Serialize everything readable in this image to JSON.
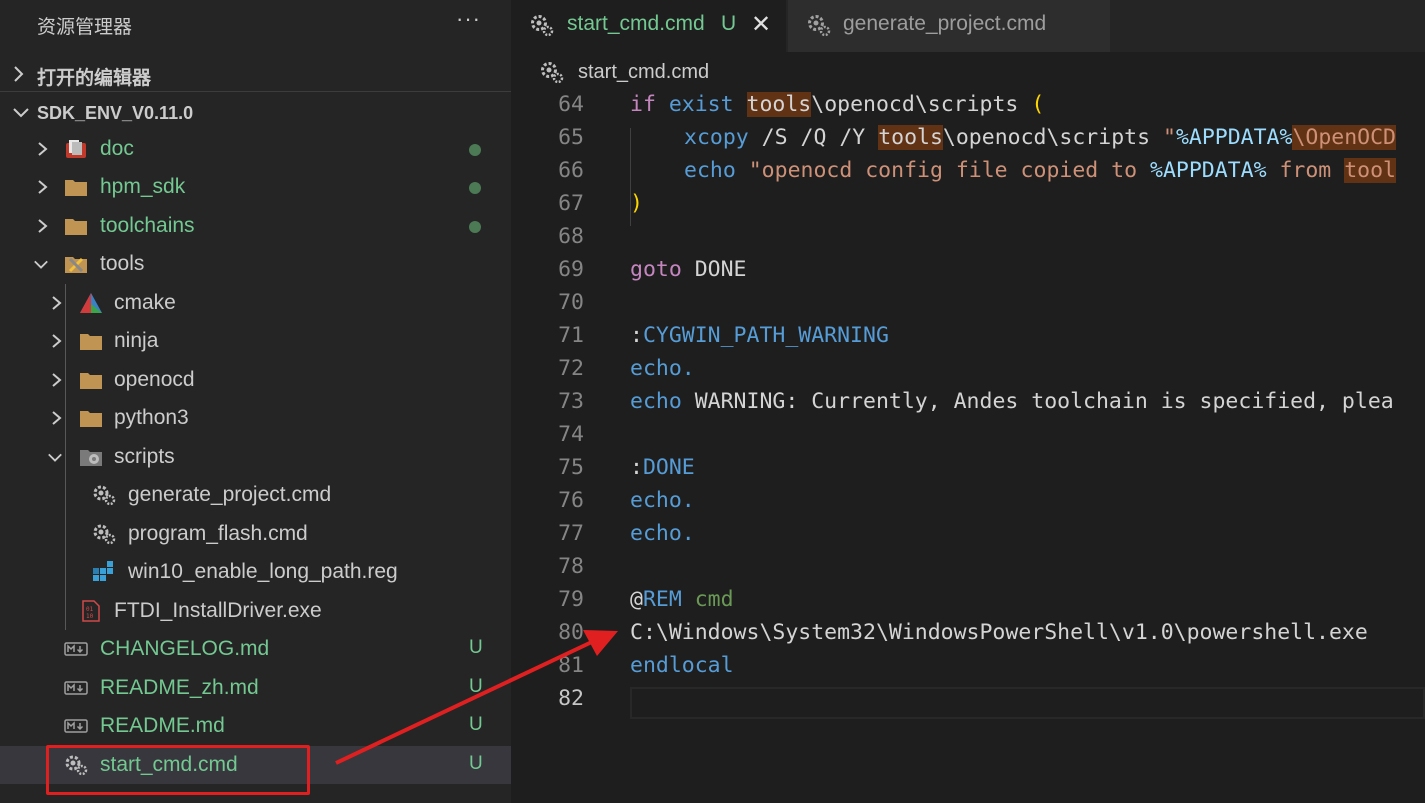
{
  "explorer": {
    "title": "资源管理器",
    "more": "···",
    "open_editors": "打开的编辑器",
    "root": "SDK_ENV_V0.11.0",
    "items": [
      {
        "label": "doc",
        "icon": "doc-folder-icon",
        "state": "dot"
      },
      {
        "label": "hpm_sdk",
        "icon": "folder-icon",
        "state": "dot"
      },
      {
        "label": "toolchains",
        "icon": "folder-icon",
        "state": "dot"
      },
      {
        "label": "tools",
        "icon": "tools-folder-icon",
        "state": ""
      },
      {
        "label": "cmake",
        "icon": "cmake-icon",
        "state": ""
      },
      {
        "label": "ninja",
        "icon": "folder-icon",
        "state": ""
      },
      {
        "label": "openocd",
        "icon": "folder-icon",
        "state": ""
      },
      {
        "label": "python3",
        "icon": "folder-icon",
        "state": ""
      },
      {
        "label": "scripts",
        "icon": "scripts-folder-icon",
        "state": ""
      },
      {
        "label": "generate_project.cmd",
        "icon": "gear-icon",
        "state": ""
      },
      {
        "label": "program_flash.cmd",
        "icon": "gear-icon",
        "state": ""
      },
      {
        "label": "win10_enable_long_path.reg",
        "icon": "registry-icon",
        "state": ""
      },
      {
        "label": "FTDI_InstallDriver.exe",
        "icon": "binary-icon",
        "state": ""
      },
      {
        "label": "CHANGELOG.md",
        "icon": "markdown-icon",
        "state": "U"
      },
      {
        "label": "README_zh.md",
        "icon": "markdown-icon",
        "state": "U"
      },
      {
        "label": "README.md",
        "icon": "markdown-icon",
        "state": "U"
      },
      {
        "label": "start_cmd.cmd",
        "icon": "gear-icon",
        "state": "U"
      }
    ]
  },
  "tabs": [
    {
      "label": "start_cmd.cmd",
      "badge": "U",
      "close": "✕"
    },
    {
      "label": "generate_project.cmd"
    }
  ],
  "breadcrumb": "start_cmd.cmd",
  "code_lines": [
    {
      "num": "64"
    },
    {
      "num": "65"
    },
    {
      "num": "66"
    },
    {
      "num": "67"
    },
    {
      "num": "68"
    },
    {
      "num": "69"
    },
    {
      "num": "70"
    },
    {
      "num": "71"
    },
    {
      "num": "72"
    },
    {
      "num": "73"
    },
    {
      "num": "74"
    },
    {
      "num": "75"
    },
    {
      "num": "76"
    },
    {
      "num": "77"
    },
    {
      "num": "78"
    },
    {
      "num": "79"
    },
    {
      "num": "80"
    },
    {
      "num": "81"
    },
    {
      "num": "82"
    }
  ],
  "code": {
    "l64": [
      "if",
      "exist",
      "tools",
      "\\openocd\\scripts",
      "("
    ],
    "l65": [
      "xcopy",
      " /S /Q /Y ",
      "tools",
      "\\openocd\\scripts ",
      "\"",
      "%APPDATA%",
      "\\OpenOCD"
    ],
    "l66": [
      "echo",
      "\"openocd config file copied to ",
      "%APPDATA%",
      " from ",
      "tool"
    ],
    "l67": ")",
    "l69": [
      "goto",
      " DONE"
    ],
    "l71": [
      ":",
      "CYGWIN_PATH_WARNING"
    ],
    "l72": "echo.",
    "l73": [
      "echo",
      " WARNING: Currently, Andes toolchain is specified, plea"
    ],
    "l75": [
      ":",
      "DONE"
    ],
    "l76": "echo.",
    "l77": "echo.",
    "l79": [
      "@",
      "REM",
      " cmd"
    ],
    "l80": "C:\\Windows\\System32\\WindowsPowerShell\\v1.0\\powershell.exe",
    "l81": "endlocal"
  },
  "colors": {
    "untracked": "#73c991",
    "keyword": "#c586c0",
    "builtin": "#569cd6",
    "string": "#ce9178",
    "annotation": "#e02020"
  }
}
